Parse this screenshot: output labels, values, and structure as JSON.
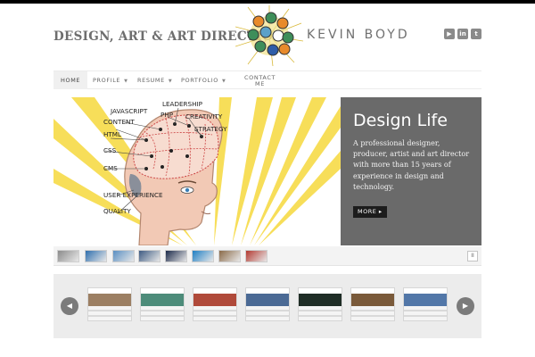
{
  "header": {
    "tagline": "DESIGN, ART & ART DIRECTION",
    "name": "KEVIN BOYD",
    "social": [
      {
        "icon": "youtube-icon",
        "glyph": "▶"
      },
      {
        "icon": "linkedin-icon",
        "glyph": "in"
      },
      {
        "icon": "twitter-icon",
        "glyph": "t"
      }
    ]
  },
  "nav": {
    "items": [
      {
        "label": "HOME",
        "active": true
      },
      {
        "label": "PROFILE",
        "has_menu": true
      },
      {
        "label": "RESUME",
        "has_menu": true
      },
      {
        "label": "PORTFOLIO",
        "has_menu": true
      },
      {
        "label": "CONTACT\nME"
      }
    ]
  },
  "hero": {
    "brain_labels": [
      "JAVASCRIPT",
      "LEADERSHIP",
      "PHP",
      "CREATIVITY",
      "CONTENT",
      "STRATEGY",
      "HTML",
      "CSS",
      "CMS",
      "USER EXPERIENCE",
      "QUALITY"
    ],
    "title": "Design Life",
    "body": "A professional designer, producer, artist and art director with more than 15 years of experience in design and technology.",
    "more_label": "MORE ▸"
  },
  "thumbstrip": {
    "thumbs": [
      {
        "icon": "photo-thumb",
        "color": "#8b8b8b"
      },
      {
        "icon": "p-logo-thumb",
        "color": "#2f6fae"
      },
      {
        "icon": "cartoon-thumb",
        "color": "#5a8fc2"
      },
      {
        "icon": "faces-thumb",
        "color": "#3e5b82"
      },
      {
        "icon": "night-thumb",
        "color": "#1c2a4a"
      },
      {
        "icon": "drupal-thumb",
        "color": "#1f7fc4"
      },
      {
        "icon": "brown-thumb",
        "color": "#8a6a48"
      },
      {
        "icon": "red-seal-thumb",
        "color": "#b33a32"
      }
    ],
    "pause_label": "II"
  },
  "carousel": {
    "prev_label": "◀",
    "next_label": "▶",
    "slides": [
      {
        "color": "#9c7f63"
      },
      {
        "color": "#4d8c7a"
      },
      {
        "color": "#b04a3a"
      },
      {
        "color": "#4b6a95"
      },
      {
        "color": "#1f2d26"
      },
      {
        "color": "#7a5a3a"
      },
      {
        "color": "#5277a8"
      }
    ]
  },
  "colors": {
    "accent_yellow": "#f6d733",
    "panel_gray": "#6a6a6a",
    "brain_pink": "#f2c9b5"
  }
}
